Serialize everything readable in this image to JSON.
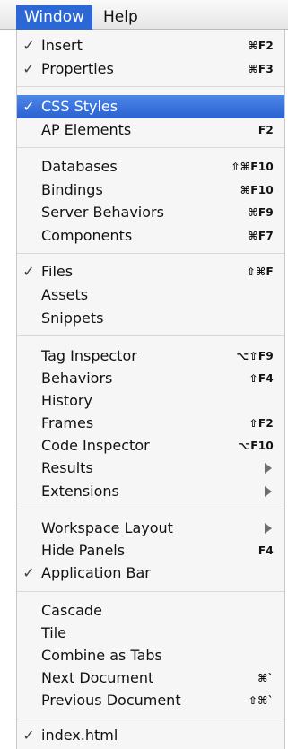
{
  "menubar": {
    "window_label": "Window",
    "help_label": "Help"
  },
  "items": [
    {
      "label": "Insert",
      "check": "✓",
      "shortcut": "⌘F2"
    },
    {
      "label": "Properties",
      "check": "✓",
      "shortcut": "⌘F3"
    },
    {
      "label": "CSS Styles",
      "check": "✓",
      "shortcut": ""
    },
    {
      "label": "AP Elements",
      "check": "",
      "shortcut": "F2"
    },
    {
      "label": "Databases",
      "check": "",
      "shortcut": "⇧⌘F10"
    },
    {
      "label": "Bindings",
      "check": "",
      "shortcut": "⌘F10"
    },
    {
      "label": "Server Behaviors",
      "check": "",
      "shortcut": "⌘F9"
    },
    {
      "label": "Components",
      "check": "",
      "shortcut": "⌘F7"
    },
    {
      "label": "Files",
      "check": "✓",
      "shortcut": "⇧⌘F"
    },
    {
      "label": "Assets",
      "check": "",
      "shortcut": ""
    },
    {
      "label": "Snippets",
      "check": "",
      "shortcut": ""
    },
    {
      "label": "Tag Inspector",
      "check": "",
      "shortcut": "⌥⇧F9"
    },
    {
      "label": "Behaviors",
      "check": "",
      "shortcut": "⇧F4"
    },
    {
      "label": "History",
      "check": "",
      "shortcut": ""
    },
    {
      "label": "Frames",
      "check": "",
      "shortcut": "⇧F2"
    },
    {
      "label": "Code Inspector",
      "check": "",
      "shortcut": "⌥F10"
    },
    {
      "label": "Results",
      "check": "",
      "shortcut": ""
    },
    {
      "label": "Extensions",
      "check": "",
      "shortcut": ""
    },
    {
      "label": "Workspace Layout",
      "check": "",
      "shortcut": ""
    },
    {
      "label": "Hide Panels",
      "check": "",
      "shortcut": "F4"
    },
    {
      "label": "Application Bar",
      "check": "✓",
      "shortcut": ""
    },
    {
      "label": "Cascade",
      "check": "",
      "shortcut": ""
    },
    {
      "label": "Tile",
      "check": "",
      "shortcut": ""
    },
    {
      "label": "Combine as Tabs",
      "check": "",
      "shortcut": ""
    },
    {
      "label": "Next Document",
      "check": "",
      "shortcut": "⌘`"
    },
    {
      "label": "Previous Document",
      "check": "",
      "shortcut": "⇧⌘`"
    },
    {
      "label": "index.html",
      "check": "✓",
      "shortcut": ""
    }
  ],
  "highlight_color": "#2c67d6"
}
